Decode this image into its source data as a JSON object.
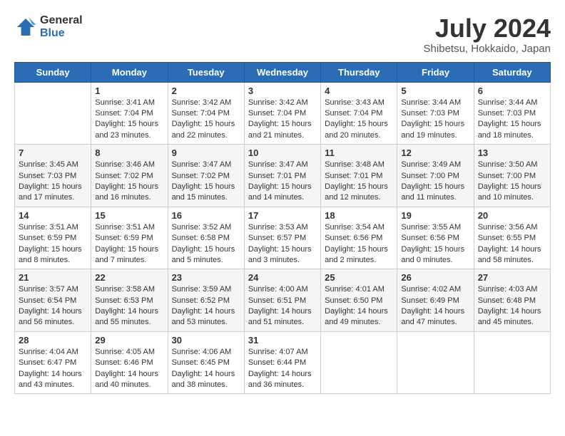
{
  "header": {
    "logo_line1": "General",
    "logo_line2": "Blue",
    "month_year": "July 2024",
    "location": "Shibetsu, Hokkaido, Japan"
  },
  "weekdays": [
    "Sunday",
    "Monday",
    "Tuesday",
    "Wednesday",
    "Thursday",
    "Friday",
    "Saturday"
  ],
  "weeks": [
    [
      {
        "day": "",
        "sunrise": "",
        "sunset": "",
        "daylight": ""
      },
      {
        "day": "1",
        "sunrise": "Sunrise: 3:41 AM",
        "sunset": "Sunset: 7:04 PM",
        "daylight": "Daylight: 15 hours and 23 minutes."
      },
      {
        "day": "2",
        "sunrise": "Sunrise: 3:42 AM",
        "sunset": "Sunset: 7:04 PM",
        "daylight": "Daylight: 15 hours and 22 minutes."
      },
      {
        "day": "3",
        "sunrise": "Sunrise: 3:42 AM",
        "sunset": "Sunset: 7:04 PM",
        "daylight": "Daylight: 15 hours and 21 minutes."
      },
      {
        "day": "4",
        "sunrise": "Sunrise: 3:43 AM",
        "sunset": "Sunset: 7:04 PM",
        "daylight": "Daylight: 15 hours and 20 minutes."
      },
      {
        "day": "5",
        "sunrise": "Sunrise: 3:44 AM",
        "sunset": "Sunset: 7:03 PM",
        "daylight": "Daylight: 15 hours and 19 minutes."
      },
      {
        "day": "6",
        "sunrise": "Sunrise: 3:44 AM",
        "sunset": "Sunset: 7:03 PM",
        "daylight": "Daylight: 15 hours and 18 minutes."
      }
    ],
    [
      {
        "day": "7",
        "sunrise": "Sunrise: 3:45 AM",
        "sunset": "Sunset: 7:03 PM",
        "daylight": "Daylight: 15 hours and 17 minutes."
      },
      {
        "day": "8",
        "sunrise": "Sunrise: 3:46 AM",
        "sunset": "Sunset: 7:02 PM",
        "daylight": "Daylight: 15 hours and 16 minutes."
      },
      {
        "day": "9",
        "sunrise": "Sunrise: 3:47 AM",
        "sunset": "Sunset: 7:02 PM",
        "daylight": "Daylight: 15 hours and 15 minutes."
      },
      {
        "day": "10",
        "sunrise": "Sunrise: 3:47 AM",
        "sunset": "Sunset: 7:01 PM",
        "daylight": "Daylight: 15 hours and 14 minutes."
      },
      {
        "day": "11",
        "sunrise": "Sunrise: 3:48 AM",
        "sunset": "Sunset: 7:01 PM",
        "daylight": "Daylight: 15 hours and 12 minutes."
      },
      {
        "day": "12",
        "sunrise": "Sunrise: 3:49 AM",
        "sunset": "Sunset: 7:00 PM",
        "daylight": "Daylight: 15 hours and 11 minutes."
      },
      {
        "day": "13",
        "sunrise": "Sunrise: 3:50 AM",
        "sunset": "Sunset: 7:00 PM",
        "daylight": "Daylight: 15 hours and 10 minutes."
      }
    ],
    [
      {
        "day": "14",
        "sunrise": "Sunrise: 3:51 AM",
        "sunset": "Sunset: 6:59 PM",
        "daylight": "Daylight: 15 hours and 8 minutes."
      },
      {
        "day": "15",
        "sunrise": "Sunrise: 3:51 AM",
        "sunset": "Sunset: 6:59 PM",
        "daylight": "Daylight: 15 hours and 7 minutes."
      },
      {
        "day": "16",
        "sunrise": "Sunrise: 3:52 AM",
        "sunset": "Sunset: 6:58 PM",
        "daylight": "Daylight: 15 hours and 5 minutes."
      },
      {
        "day": "17",
        "sunrise": "Sunrise: 3:53 AM",
        "sunset": "Sunset: 6:57 PM",
        "daylight": "Daylight: 15 hours and 3 minutes."
      },
      {
        "day": "18",
        "sunrise": "Sunrise: 3:54 AM",
        "sunset": "Sunset: 6:56 PM",
        "daylight": "Daylight: 15 hours and 2 minutes."
      },
      {
        "day": "19",
        "sunrise": "Sunrise: 3:55 AM",
        "sunset": "Sunset: 6:56 PM",
        "daylight": "Daylight: 15 hours and 0 minutes."
      },
      {
        "day": "20",
        "sunrise": "Sunrise: 3:56 AM",
        "sunset": "Sunset: 6:55 PM",
        "daylight": "Daylight: 14 hours and 58 minutes."
      }
    ],
    [
      {
        "day": "21",
        "sunrise": "Sunrise: 3:57 AM",
        "sunset": "Sunset: 6:54 PM",
        "daylight": "Daylight: 14 hours and 56 minutes."
      },
      {
        "day": "22",
        "sunrise": "Sunrise: 3:58 AM",
        "sunset": "Sunset: 6:53 PM",
        "daylight": "Daylight: 14 hours and 55 minutes."
      },
      {
        "day": "23",
        "sunrise": "Sunrise: 3:59 AM",
        "sunset": "Sunset: 6:52 PM",
        "daylight": "Daylight: 14 hours and 53 minutes."
      },
      {
        "day": "24",
        "sunrise": "Sunrise: 4:00 AM",
        "sunset": "Sunset: 6:51 PM",
        "daylight": "Daylight: 14 hours and 51 minutes."
      },
      {
        "day": "25",
        "sunrise": "Sunrise: 4:01 AM",
        "sunset": "Sunset: 6:50 PM",
        "daylight": "Daylight: 14 hours and 49 minutes."
      },
      {
        "day": "26",
        "sunrise": "Sunrise: 4:02 AM",
        "sunset": "Sunset: 6:49 PM",
        "daylight": "Daylight: 14 hours and 47 minutes."
      },
      {
        "day": "27",
        "sunrise": "Sunrise: 4:03 AM",
        "sunset": "Sunset: 6:48 PM",
        "daylight": "Daylight: 14 hours and 45 minutes."
      }
    ],
    [
      {
        "day": "28",
        "sunrise": "Sunrise: 4:04 AM",
        "sunset": "Sunset: 6:47 PM",
        "daylight": "Daylight: 14 hours and 43 minutes."
      },
      {
        "day": "29",
        "sunrise": "Sunrise: 4:05 AM",
        "sunset": "Sunset: 6:46 PM",
        "daylight": "Daylight: 14 hours and 40 minutes."
      },
      {
        "day": "30",
        "sunrise": "Sunrise: 4:06 AM",
        "sunset": "Sunset: 6:45 PM",
        "daylight": "Daylight: 14 hours and 38 minutes."
      },
      {
        "day": "31",
        "sunrise": "Sunrise: 4:07 AM",
        "sunset": "Sunset: 6:44 PM",
        "daylight": "Daylight: 14 hours and 36 minutes."
      },
      {
        "day": "",
        "sunrise": "",
        "sunset": "",
        "daylight": ""
      },
      {
        "day": "",
        "sunrise": "",
        "sunset": "",
        "daylight": ""
      },
      {
        "day": "",
        "sunrise": "",
        "sunset": "",
        "daylight": ""
      }
    ]
  ]
}
